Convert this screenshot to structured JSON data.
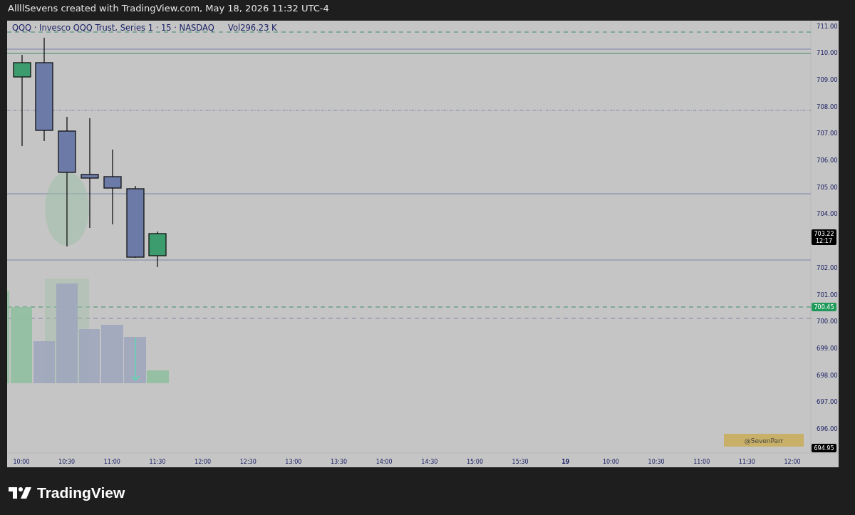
{
  "header": {
    "text": "AllllSevens created with TradingView.com, May 18, 2026 11:32 UTC-4"
  },
  "chart": {
    "legend": {
      "symbol": "QQQ · Invesco QQQ Trust, Series 1 · 15 · NASDAQ",
      "volume": "Vol296.23 K"
    },
    "price_ticks": [
      {
        "label": "711.00"
      },
      {
        "label": "710.00"
      },
      {
        "label": "709.00"
      },
      {
        "label": "708.00"
      },
      {
        "label": "707.00"
      },
      {
        "label": "706.00"
      },
      {
        "label": "705.00"
      },
      {
        "label": "704.00"
      },
      {
        "label": "702.00"
      },
      {
        "label": "701.00"
      },
      {
        "label": "700.00"
      },
      {
        "label": "699.00"
      },
      {
        "label": "698.00"
      },
      {
        "label": "697.00"
      },
      {
        "label": "696.00"
      }
    ],
    "price_tags": [
      {
        "kind": "last",
        "price": "703.22",
        "countdown": "12:17"
      },
      {
        "kind": "alert",
        "price": "700.45"
      },
      {
        "kind": "low",
        "price": "694.95"
      }
    ],
    "time_ticks": [
      {
        "label": "10:00",
        "bold": false
      },
      {
        "label": "10:30",
        "bold": false
      },
      {
        "label": "11:00",
        "bold": false
      },
      {
        "label": "11:30",
        "bold": false
      },
      {
        "label": "12:00",
        "bold": false
      },
      {
        "label": "12:30",
        "bold": false
      },
      {
        "label": "13:00",
        "bold": false
      },
      {
        "label": "13:30",
        "bold": false
      },
      {
        "label": "14:00",
        "bold": false
      },
      {
        "label": "14:30",
        "bold": false
      },
      {
        "label": "15:00",
        "bold": false
      },
      {
        "label": "15:30",
        "bold": false
      },
      {
        "label": "19",
        "bold": true
      },
      {
        "label": "10:00",
        "bold": false
      },
      {
        "label": "10:30",
        "bold": false
      },
      {
        "label": "11:00",
        "bold": false
      },
      {
        "label": "11:30",
        "bold": false
      },
      {
        "label": "12:00",
        "bold": false
      }
    ],
    "note": "@SevenParr"
  },
  "logo": {
    "text": "TradingView"
  }
}
